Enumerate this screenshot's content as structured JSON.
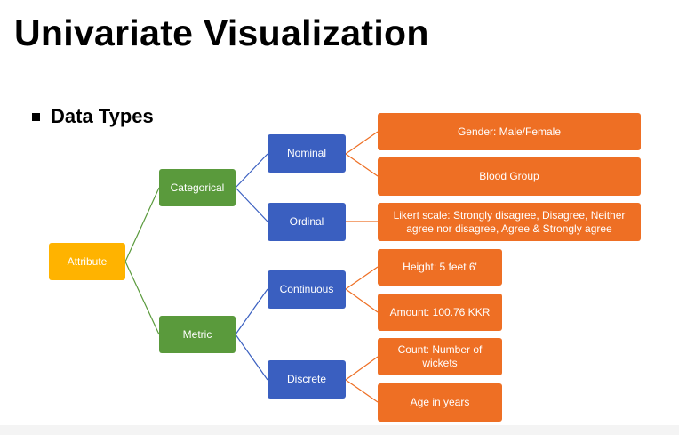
{
  "slide": {
    "title": "Univariate Visualization",
    "bullet": "Data Types"
  },
  "diagram": {
    "root": "Attribute",
    "level1": [
      "Categorical",
      "Metric"
    ],
    "level2": [
      "Nominal",
      "Ordinal",
      "Continuous",
      "Discrete"
    ],
    "examples": {
      "nominal": [
        "Gender: Male/Female",
        "Blood Group"
      ],
      "ordinal": [
        "Likert scale: Strongly disagree, Disagree, Neither agree nor disagree, Agree & Strongly agree"
      ],
      "continuous": [
        "Height: 5 feet 6'",
        "Amount: 100.76 KKR"
      ],
      "discrete": [
        "Count: Number of wickets",
        "Age in years"
      ]
    },
    "colors": {
      "root": "#ffb300",
      "level1": "#5a9a3c",
      "level2": "#3a5fc0",
      "examples": "#ee6f24",
      "root_links": "#5a9a3c",
      "level1_links": "#3a5fc0",
      "level2_links": "#ee6f24"
    }
  }
}
